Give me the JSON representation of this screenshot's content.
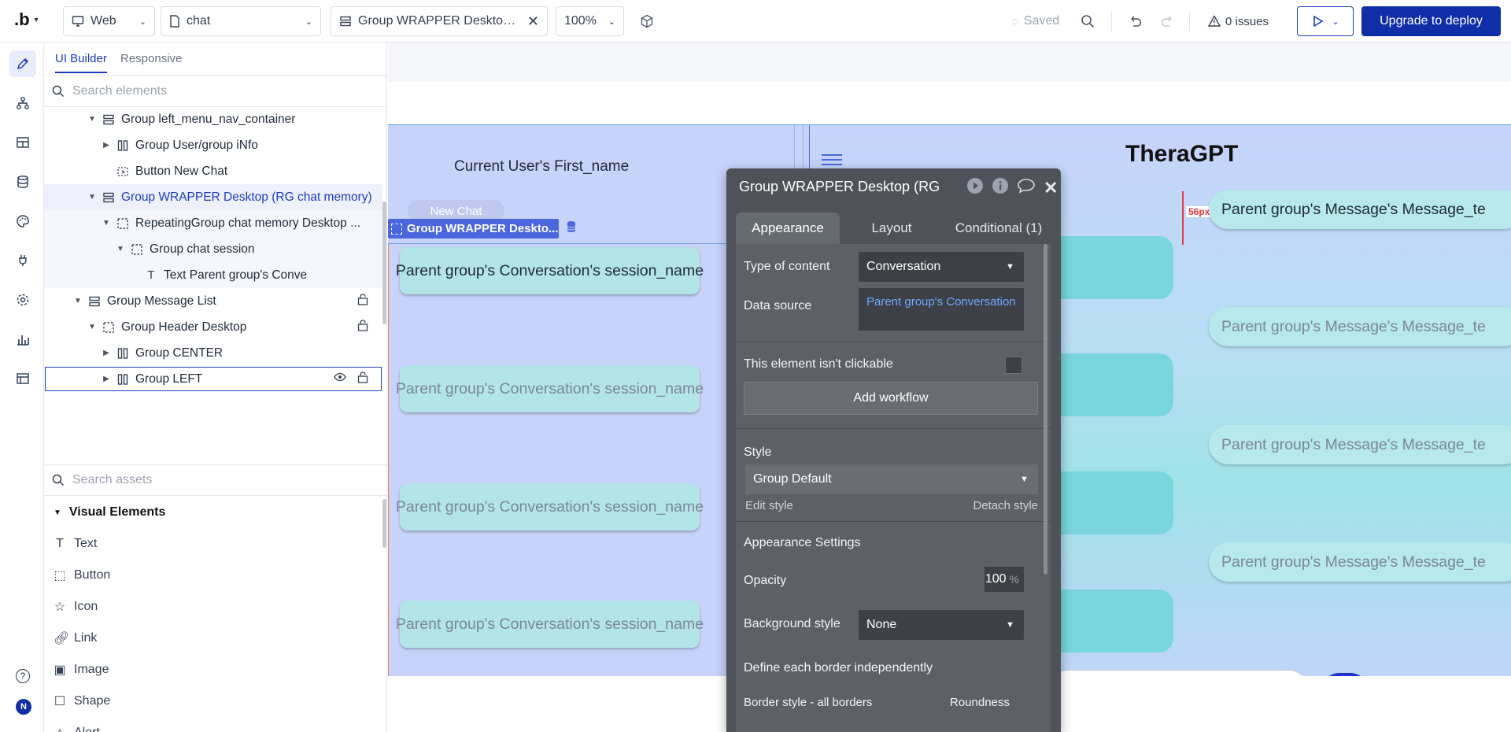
{
  "topbar": {
    "logo": ".b",
    "platform": "Web",
    "page": "chat",
    "element": "Group WRAPPER Desktop (...",
    "zoom": "100%",
    "saved": "Saved",
    "issues": "0 issues",
    "deploy": "Upgrade to deploy"
  },
  "rail": {
    "items": [
      "pencil-icon",
      "workflow-icon",
      "layout-icon",
      "database-icon",
      "palette-icon",
      "plugin-icon",
      "settings-icon",
      "chart-icon",
      "table-icon"
    ],
    "help": "?",
    "avatar": "N"
  },
  "panel": {
    "tabs": [
      "UI Builder",
      "Responsive"
    ],
    "search_placeholder": "Search elements",
    "tree": [
      {
        "label": "Group left_menu_nav_container",
        "indent": 1,
        "arrow": "down",
        "icon": "stack"
      },
      {
        "label": "Group User/group iNfo",
        "indent": 2,
        "arrow": "right",
        "icon": "columns"
      },
      {
        "label": "Button New Chat",
        "indent": 2,
        "arrow": "",
        "icon": "button"
      },
      {
        "label": "Group WRAPPER Desktop (RG chat memory)",
        "indent": 1,
        "arrow": "down",
        "icon": "stack",
        "state": "sel"
      },
      {
        "label": "RepeatingGroup chat memory Desktop ...",
        "indent": 2,
        "arrow": "down",
        "icon": "dashed",
        "state": "sub"
      },
      {
        "label": "Group chat session",
        "indent": 3,
        "arrow": "down",
        "icon": "dashed",
        "state": "sub"
      },
      {
        "label": "Text Parent group's Conve",
        "indent": 4,
        "arrow": "",
        "icon": "text",
        "state": "sub"
      },
      {
        "label": "Group Message List",
        "indent": 0,
        "arrow": "down",
        "icon": "stack",
        "lock": true
      },
      {
        "label": "Group Header Desktop",
        "indent": 1,
        "arrow": "down",
        "icon": "dashed",
        "lock": true
      },
      {
        "label": "Group CENTER",
        "indent": 2,
        "arrow": "right",
        "icon": "columns"
      },
      {
        "label": "Group LEFT",
        "indent": 2,
        "arrow": "right",
        "icon": "columns",
        "state": "hl",
        "eye": true,
        "lock": true
      }
    ],
    "assets_placeholder": "Search assets",
    "assets_header": "Visual Elements",
    "assets": [
      "Text",
      "Button",
      "Icon",
      "Link",
      "Image",
      "Shape",
      "Alert"
    ]
  },
  "canvas": {
    "current_user": "Current User's First_name",
    "new_chat": "New Chat",
    "wrapper_tag": "Group WRAPPER Deskto...",
    "sessions": [
      "Parent group's Conversation's session_name",
      "Parent group's Conversation's session_name",
      "Parent group's Conversation's session_name",
      "Parent group's Conversation's session_name"
    ],
    "title": "TheraGPT",
    "messages": [
      "Parent group's Message's Message_te",
      "Parent group's Message's Message_te",
      "Parent group's Message's Message_te",
      "Parent group's Message's Message_te"
    ],
    "spacing_tag": "56px"
  },
  "editor": {
    "title": "Group WRAPPER Desktop (RG ch",
    "tabs": [
      "Appearance",
      "Layout",
      "Conditional (1)"
    ],
    "type_label": "Type of content",
    "type_value": "Conversation",
    "source_label": "Data source",
    "source_value": "Parent group's Conversation",
    "clickable_label": "This element isn't clickable",
    "add_workflow": "Add workflow",
    "style_label": "Style",
    "style_value": "Group Default",
    "edit_style": "Edit style",
    "detach_style": "Detach style",
    "appearance_settings": "Appearance Settings",
    "opacity_label": "Opacity",
    "opacity_value": "100",
    "opacity_unit": "%",
    "bg_label": "Background style",
    "bg_value": "None",
    "border_independent": "Define each border independently",
    "border_style": "Border style - all borders",
    "roundness": "Roundness"
  }
}
